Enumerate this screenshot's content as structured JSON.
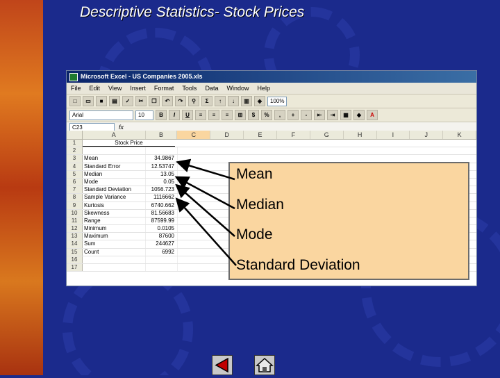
{
  "slide": {
    "title": "Descriptive Statistics- Stock Prices",
    "colors": {
      "background": "#1b2a8c",
      "title": "#ffffff",
      "callout_bg": "#fad6a0"
    }
  },
  "excel": {
    "window_title": "Microsoft Excel - US Companies 2005.xls",
    "menus": [
      "File",
      "Edit",
      "View",
      "Insert",
      "Format",
      "Tools",
      "Data",
      "Window",
      "Help"
    ],
    "font_name": "Arial",
    "font_size": "10",
    "zoom": "100%",
    "name_box": "C23",
    "fx": "fx",
    "columns": [
      "A",
      "B",
      "C",
      "D",
      "E",
      "F",
      "G",
      "H",
      "I",
      "J",
      "K"
    ],
    "header_label": "Stock Price",
    "rows": [
      {
        "num": "1",
        "label": "",
        "value": ""
      },
      {
        "num": "2",
        "label": "",
        "value": ""
      },
      {
        "num": "3",
        "label": "Mean",
        "value": "34.9867"
      },
      {
        "num": "4",
        "label": "Standard Error",
        "value": "12.53747"
      },
      {
        "num": "5",
        "label": "Median",
        "value": "13.05"
      },
      {
        "num": "6",
        "label": "Mode",
        "value": "0.05"
      },
      {
        "num": "7",
        "label": "Standard Deviation",
        "value": "1056.723"
      },
      {
        "num": "8",
        "label": "Sample Variance",
        "value": "1116662"
      },
      {
        "num": "9",
        "label": "Kurtosis",
        "value": "6740.662"
      },
      {
        "num": "10",
        "label": "Skewness",
        "value": "81.56683"
      },
      {
        "num": "11",
        "label": "Range",
        "value": "87599.99"
      },
      {
        "num": "12",
        "label": "Minimum",
        "value": "0.0105"
      },
      {
        "num": "13",
        "label": "Maximum",
        "value": "87600"
      },
      {
        "num": "14",
        "label": "Sum",
        "value": "244627"
      },
      {
        "num": "15",
        "label": "Count",
        "value": "6992"
      },
      {
        "num": "16",
        "label": "",
        "value": ""
      },
      {
        "num": "17",
        "label": "",
        "value": ""
      }
    ]
  },
  "callout": {
    "items": [
      "Mean",
      "Median",
      "Mode",
      "Standard Deviation"
    ]
  },
  "nav": {
    "back_icon": "back-triangle-icon",
    "home_icon": "home-icon"
  }
}
